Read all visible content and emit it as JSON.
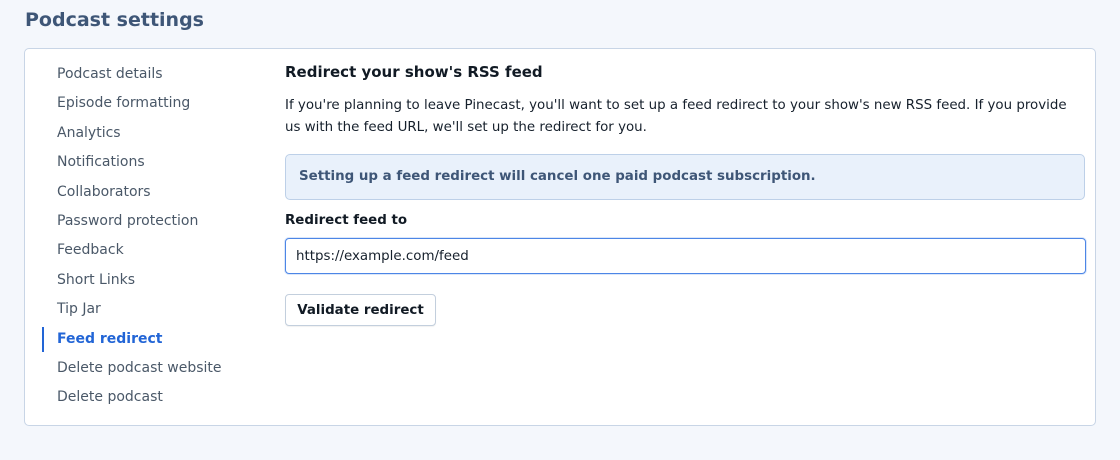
{
  "page": {
    "title": "Podcast settings"
  },
  "sidebar": {
    "active_index": 9,
    "items": [
      {
        "label": "Podcast details"
      },
      {
        "label": "Episode formatting"
      },
      {
        "label": "Analytics"
      },
      {
        "label": "Notifications"
      },
      {
        "label": "Collaborators"
      },
      {
        "label": "Password protection"
      },
      {
        "label": "Feedback"
      },
      {
        "label": "Short Links"
      },
      {
        "label": "Tip Jar"
      },
      {
        "label": "Feed redirect"
      },
      {
        "label": "Delete podcast website"
      },
      {
        "label": "Delete podcast"
      }
    ]
  },
  "main": {
    "section_title": "Redirect your show's RSS feed",
    "description": "If you're planning to leave Pinecast, you'll want to set up a feed redirect to your show's new RSS feed. If you provide us with the feed URL, we'll set up the redirect for you.",
    "notice": "Setting up a feed redirect will cancel one paid podcast subscription.",
    "field_label": "Redirect feed to",
    "input_value": "https://example.com/feed",
    "button_label": "Validate redirect"
  },
  "colors": {
    "title": "#3e5677",
    "accent": "#2265d6",
    "notice_bg": "#e9f1fb",
    "page_bg": "#f4f7fc"
  }
}
